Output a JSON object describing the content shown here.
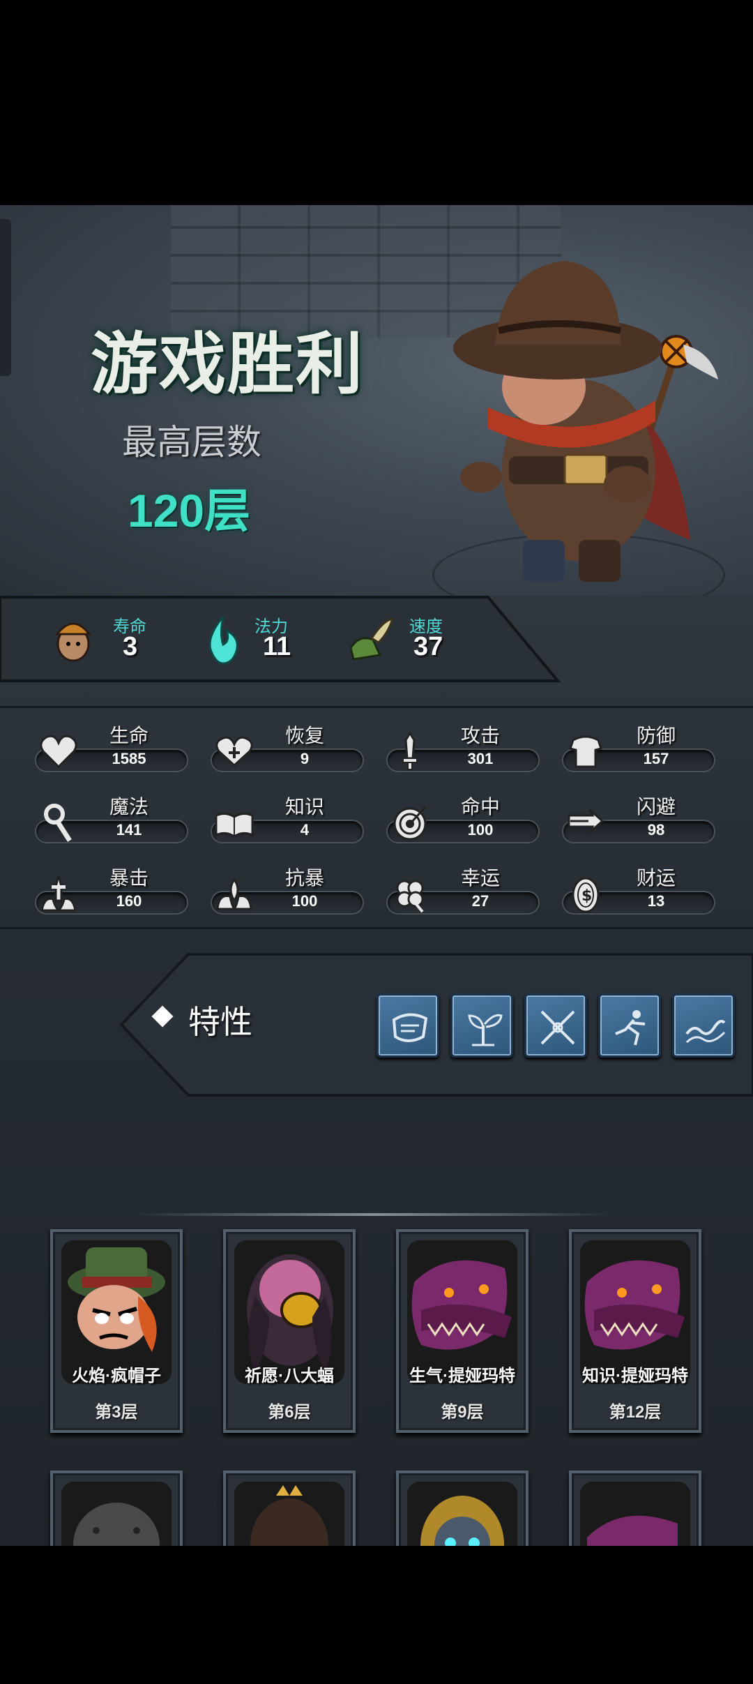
{
  "result": {
    "title": "游戏胜利",
    "subtitle": "最高层数",
    "floors": "120层"
  },
  "base_stats": [
    {
      "label": "寿命",
      "value": "3",
      "icon": "lifespan-icon"
    },
    {
      "label": "法力",
      "value": "11",
      "icon": "mana-flame-icon"
    },
    {
      "label": "速度",
      "value": "37",
      "icon": "winged-boot-icon"
    }
  ],
  "attributes": [
    {
      "label": "生命",
      "value": "1585",
      "icon": "heart-icon"
    },
    {
      "label": "恢复",
      "value": "9",
      "icon": "heal-heart-icon"
    },
    {
      "label": "攻击",
      "value": "301",
      "icon": "sword-icon"
    },
    {
      "label": "防御",
      "value": "157",
      "icon": "armor-icon"
    },
    {
      "label": "魔法",
      "value": "141",
      "icon": "staff-icon"
    },
    {
      "label": "知识",
      "value": "4",
      "icon": "book-icon"
    },
    {
      "label": "命中",
      "value": "100",
      "icon": "target-icon"
    },
    {
      "label": "闪避",
      "value": "98",
      "icon": "dodge-arrow-icon"
    },
    {
      "label": "暴击",
      "value": "160",
      "icon": "critical-icon"
    },
    {
      "label": "抗暴",
      "value": "100",
      "icon": "crit-resist-icon"
    },
    {
      "label": "幸运",
      "value": "27",
      "icon": "clover-icon"
    },
    {
      "label": "财运",
      "value": "13",
      "icon": "coin-icon"
    }
  ],
  "traits": {
    "label": "特性",
    "icons": [
      "scroll-trait-icon",
      "sprout-trait-icon",
      "crossed-blades-trait-icon",
      "leaping-figure-trait-icon",
      "wave-trait-icon"
    ]
  },
  "bosses": [
    {
      "name": "火焰·疯帽子",
      "floor": "第3层",
      "portrait": "mad-hatter"
    },
    {
      "name": "祈愿·八大蝠",
      "floor": "第6层",
      "portrait": "bat-creature"
    },
    {
      "name": "生气·提娅玛特",
      "floor": "第9层",
      "portrait": "tiamat-dragon"
    },
    {
      "name": "知识·提娅玛特",
      "floor": "第12层",
      "portrait": "tiamat-dragon"
    }
  ],
  "colors": {
    "accent": "#3fe0c5",
    "stat_label": "#4ed9d4",
    "trait_icon_bg": "#4b79a3"
  }
}
